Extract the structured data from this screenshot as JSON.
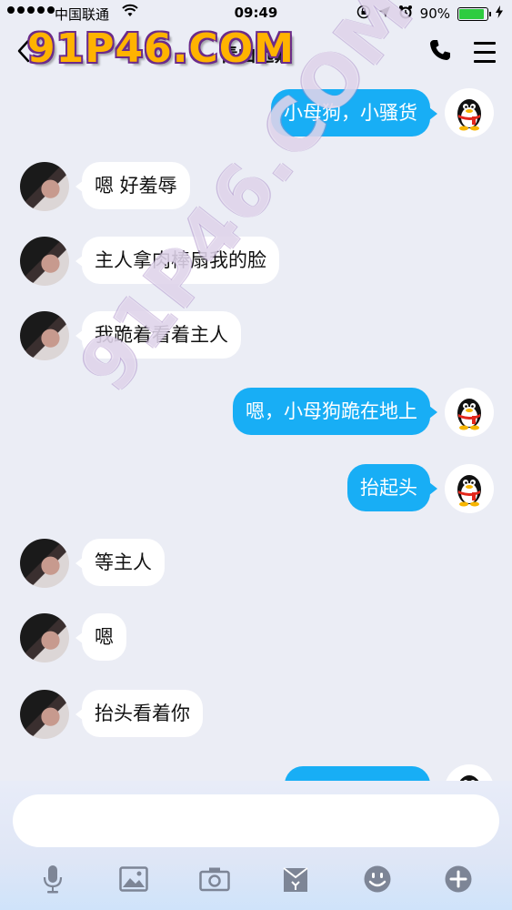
{
  "status_bar": {
    "carrier": "中国联通",
    "time": "09:49",
    "battery": "90%",
    "battery_level": 0.9
  },
  "header": {
    "back_label": "<",
    "title": "青山远黛"
  },
  "watermark": {
    "text": "91P46.COM"
  },
  "messages": [
    {
      "side": "right",
      "text": "小母狗，小骚货"
    },
    {
      "side": "left",
      "text": "嗯 好羞辱"
    },
    {
      "side": "left",
      "text": "主人拿肉棒扇我的脸"
    },
    {
      "side": "left",
      "text": "我跪着看着主人"
    },
    {
      "side": "right",
      "text": "嗯，小母狗跪在地上"
    },
    {
      "side": "right",
      "text": "抬起头"
    },
    {
      "side": "left",
      "text": "等主人"
    },
    {
      "side": "left",
      "text": "嗯"
    },
    {
      "side": "left",
      "text": "抬头看着你"
    }
  ],
  "composer": {
    "placeholder": ""
  },
  "toolbar": {
    "icons": [
      "microphone-icon",
      "image-icon",
      "camera-icon",
      "red-packet-icon",
      "emoji-icon",
      "plus-icon"
    ]
  },
  "colors": {
    "background": "#ebedf5",
    "outgoing_bubble": "#18aef5",
    "incoming_bubble": "#ffffff",
    "watermark": "#ffb300"
  }
}
